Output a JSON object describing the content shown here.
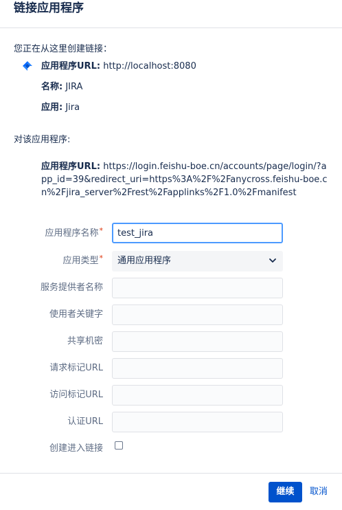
{
  "dialog": {
    "title": "链接应用程序"
  },
  "from_section": {
    "heading": "您正在从这里创建链接：",
    "url_label": "应用程序URL:",
    "url_value": "http://localhost:8080",
    "name_label": "名称:",
    "name_value": "JIRA",
    "app_label": "应用:",
    "app_value": "Jira",
    "icon": "jira-icon"
  },
  "to_section": {
    "heading": "对该应用程序:",
    "url_label": "应用程序URL:",
    "url_value": "https://login.feishu-boe.cn/accounts/page/login/?app_id=39&redirect_uri=https%3A%2F%2Fanycross.feishu-boe.cn%2Fjira_server%2Frest%2Fapplinks%2F1.0%2Fmanifest"
  },
  "form": {
    "app_name_label": "应用程序名称",
    "app_name_value": "test_jira",
    "app_type_label": "应用类型",
    "app_type_value": "通用应用程序",
    "service_provider_label": "服务提供者名称",
    "service_provider_value": "",
    "consumer_key_label": "使用者关键字",
    "consumer_key_value": "",
    "shared_secret_label": "共享机密",
    "shared_secret_value": "",
    "request_token_label": "请求标记URL",
    "request_token_value": "",
    "access_token_label": "访问标记URL",
    "access_token_value": "",
    "auth_url_label": "认证URL",
    "auth_url_value": "",
    "create_incoming_label": "创建进入链接",
    "required_marker": "*"
  },
  "footer": {
    "continue_label": "继续",
    "cancel_label": "取消"
  },
  "colors": {
    "primary": "#0052cc",
    "focus_border": "#4c9aff",
    "required": "#de350b"
  }
}
